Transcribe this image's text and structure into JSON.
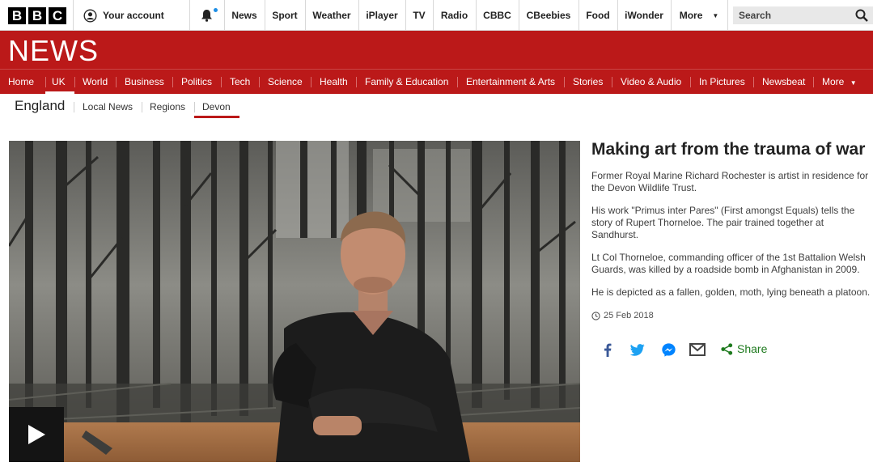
{
  "bbc_logo": [
    "B",
    "B",
    "C"
  ],
  "top_nav": {
    "account_label": "Your account",
    "links": [
      "News",
      "Sport",
      "Weather",
      "iPlayer",
      "TV",
      "Radio",
      "CBBC",
      "CBeebies",
      "Food",
      "iWonder"
    ],
    "more_label": "More",
    "search_label": "Search"
  },
  "news_logo": "NEWS",
  "news_nav": {
    "items": [
      "Home",
      "UK",
      "World",
      "Business",
      "Politics",
      "Tech",
      "Science",
      "Health",
      "Family & Education",
      "Entertainment & Arts",
      "Stories",
      "Video & Audio",
      "In Pictures",
      "Newsbeat"
    ],
    "more_label": "More",
    "active": "UK"
  },
  "sub_nav": {
    "section": "England",
    "links": [
      "Local News",
      "Regions",
      "Devon"
    ],
    "active": "Devon"
  },
  "story": {
    "headline": "Making art from the trauma of war",
    "paragraphs": [
      "Former Royal Marine Richard Rochester is artist in residence for the Devon Wildlife Trust.",
      "His work \"Primus inter Pares\" (First amongst Equals) tells the story of Rupert Thorneloe. The pair trained together at Sandhurst.",
      "Lt Col Thorneloe, commanding officer of the 1st Battalion Welsh Guards, was killed by a roadside bomb in Afghanistan in 2009.",
      "He is depicted as a fallen, golden, moth, lying beneath a platoon."
    ],
    "date": "25 Feb 2018"
  },
  "share": {
    "icons": [
      "facebook-icon",
      "twitter-icon",
      "messenger-icon",
      "email-icon"
    ],
    "label": "Share"
  },
  "colors": {
    "bbc_red": "#bb1919",
    "share_green": "#1e7a1e",
    "facebook_blue": "#3b5998",
    "twitter_blue": "#1da1f2",
    "messenger_blue": "#0084ff"
  }
}
